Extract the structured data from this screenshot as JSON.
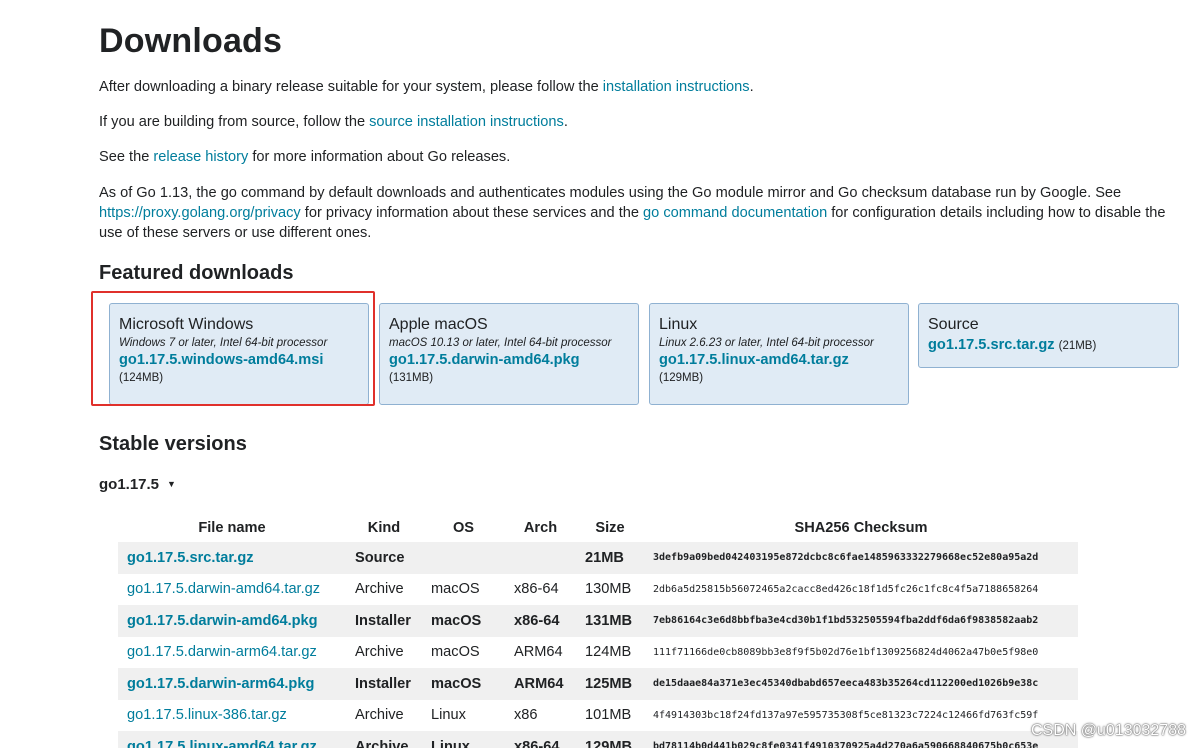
{
  "title": "Downloads",
  "intro": {
    "p1_before": "After downloading a binary release suitable for your system, please follow the ",
    "p1_link": "installation instructions",
    "p1_after": ".",
    "p2_before": "If you are building from source, follow the ",
    "p2_link": "source installation instructions",
    "p2_after": ".",
    "p3_before": "See the ",
    "p3_link": "release history",
    "p3_after": " for more information about Go releases.",
    "p4_a": "As of Go 1.13, the go command by default downloads and authenticates modules using the Go module mirror and Go checksum database run by Google. See ",
    "p4_link1": "https://proxy.golang.org/privacy",
    "p4_b": " for privacy information about these services and the ",
    "p4_link2": "go command documentation",
    "p4_c": " for configuration details including how to disable the use of these servers or use different ones."
  },
  "featured": {
    "heading": "Featured downloads",
    "cards": [
      {
        "os": "Microsoft Windows",
        "req": "Windows 7 or later, Intel 64-bit processor",
        "file": "go1.17.5.windows-amd64.msi",
        "size": "(124MB)"
      },
      {
        "os": "Apple macOS",
        "req": "macOS 10.13 or later, Intel 64-bit processor",
        "file": "go1.17.5.darwin-amd64.pkg",
        "size": "(131MB)"
      },
      {
        "os": "Linux",
        "req": "Linux 2.6.23 or later, Intel 64-bit processor",
        "file": "go1.17.5.linux-amd64.tar.gz",
        "size": "(129MB)"
      },
      {
        "os": "Source",
        "req": "",
        "file": "go1.17.5.src.tar.gz",
        "size": "(21MB)"
      }
    ]
  },
  "stable": {
    "heading": "Stable versions",
    "version": "go1.17.5",
    "caret": "▼",
    "columns": [
      "File name",
      "Kind",
      "OS",
      "Arch",
      "Size",
      "SHA256 Checksum"
    ],
    "rows": [
      {
        "file": "go1.17.5.src.tar.gz",
        "kind": "Source",
        "os": "",
        "arch": "",
        "size": "21MB",
        "sha": "3defb9a09bed042403195e872dcbc8c6fae1485963332279668ec52e80a95a2d"
      },
      {
        "file": "go1.17.5.darwin-amd64.tar.gz",
        "kind": "Archive",
        "os": "macOS",
        "arch": "x86-64",
        "size": "130MB",
        "sha": "2db6a5d25815b56072465a2cacc8ed426c18f1d5fc26c1fc8c4f5a7188658264"
      },
      {
        "file": "go1.17.5.darwin-amd64.pkg",
        "kind": "Installer",
        "os": "macOS",
        "arch": "x86-64",
        "size": "131MB",
        "sha": "7eb86164c3e6d8bbfba3e4cd30b1f1bd532505594fba2ddf6da6f9838582aab2"
      },
      {
        "file": "go1.17.5.darwin-arm64.tar.gz",
        "kind": "Archive",
        "os": "macOS",
        "arch": "ARM64",
        "size": "124MB",
        "sha": "111f71166de0cb8089bb3e8f9f5b02d76e1bf1309256824d4062a47b0e5f98e0"
      },
      {
        "file": "go1.17.5.darwin-arm64.pkg",
        "kind": "Installer",
        "os": "macOS",
        "arch": "ARM64",
        "size": "125MB",
        "sha": "de15daae84a371e3ec45340dbabd657eeca483b35264cd112200ed1026b9e38c"
      },
      {
        "file": "go1.17.5.linux-386.tar.gz",
        "kind": "Archive",
        "os": "Linux",
        "arch": "x86",
        "size": "101MB",
        "sha": "4f4914303bc18f24fd137a97e595735308f5ce81323c7224c12466fd763fc59f"
      },
      {
        "file": "go1.17.5.linux-amd64.tar.gz",
        "kind": "Archive",
        "os": "Linux",
        "arch": "x86-64",
        "size": "129MB",
        "sha": "bd78114b0d441b029c8fe0341f4910370925a4d270a6a590668840675b0c653e"
      }
    ]
  },
  "watermark": "CSDN @u013032788",
  "colors": {
    "link": "#007d9c",
    "card_bg": "#e0ebf5",
    "card_border": "#8fb1d1",
    "highlight": "#e0302b",
    "row_alt": "#f0f0f0"
  }
}
